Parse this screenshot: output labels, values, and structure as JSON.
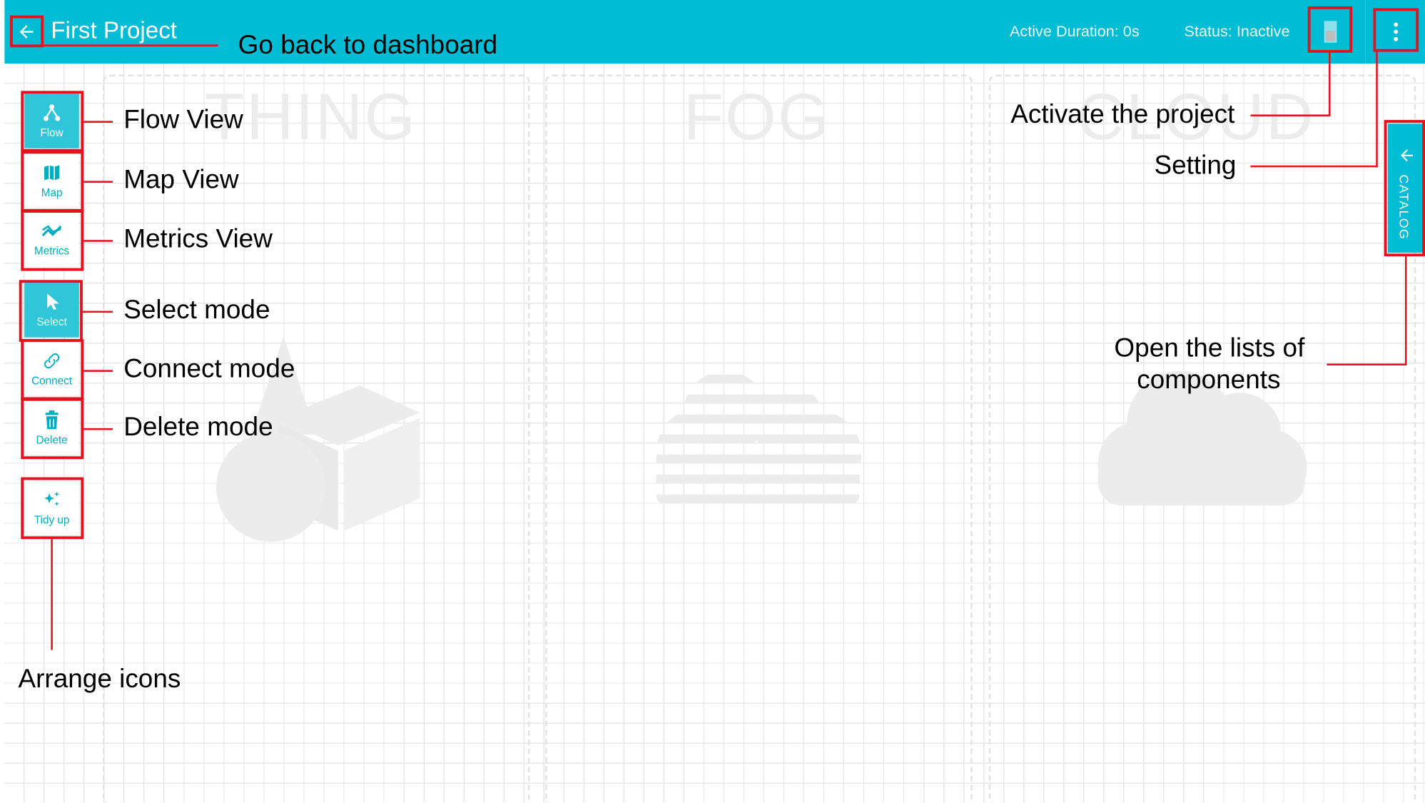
{
  "header": {
    "project_title": "First Project",
    "active_duration": "Active Duration: 0s",
    "status": "Status: Inactive",
    "background_color": "#00bcd4"
  },
  "zones": [
    {
      "title": "THING"
    },
    {
      "title": "FOG"
    },
    {
      "title": "CLOUD"
    }
  ],
  "toolbar": {
    "flow_label": "Flow",
    "map_label": "Map",
    "metrics_label": "Metrics",
    "select_label": "Select",
    "connect_label": "Connect",
    "delete_label": "Delete",
    "tidy_label": "Tidy up"
  },
  "catalog": {
    "label": "CATALOG"
  },
  "annotations": {
    "back": "Go back to dashboard",
    "flow": "Flow View",
    "map": "Map View",
    "metrics": "Metrics View",
    "select": "Select mode",
    "connect": "Connect mode",
    "delete": "Delete mode",
    "arrange": "Arrange icons",
    "activate": "Activate the project",
    "setting": "Setting",
    "catalog_line1": "Open the lists of",
    "catalog_line2": "components",
    "highlight_color": "#e4111f"
  },
  "icons": [
    "arrow-left-icon",
    "toggle-icon",
    "more-vert-icon",
    "flow-icon",
    "map-icon",
    "metrics-icon",
    "cursor-icon",
    "link-icon",
    "trash-icon",
    "sparkle-icon",
    "thing-shapes-icon",
    "fog-icon",
    "cloud-icon"
  ]
}
